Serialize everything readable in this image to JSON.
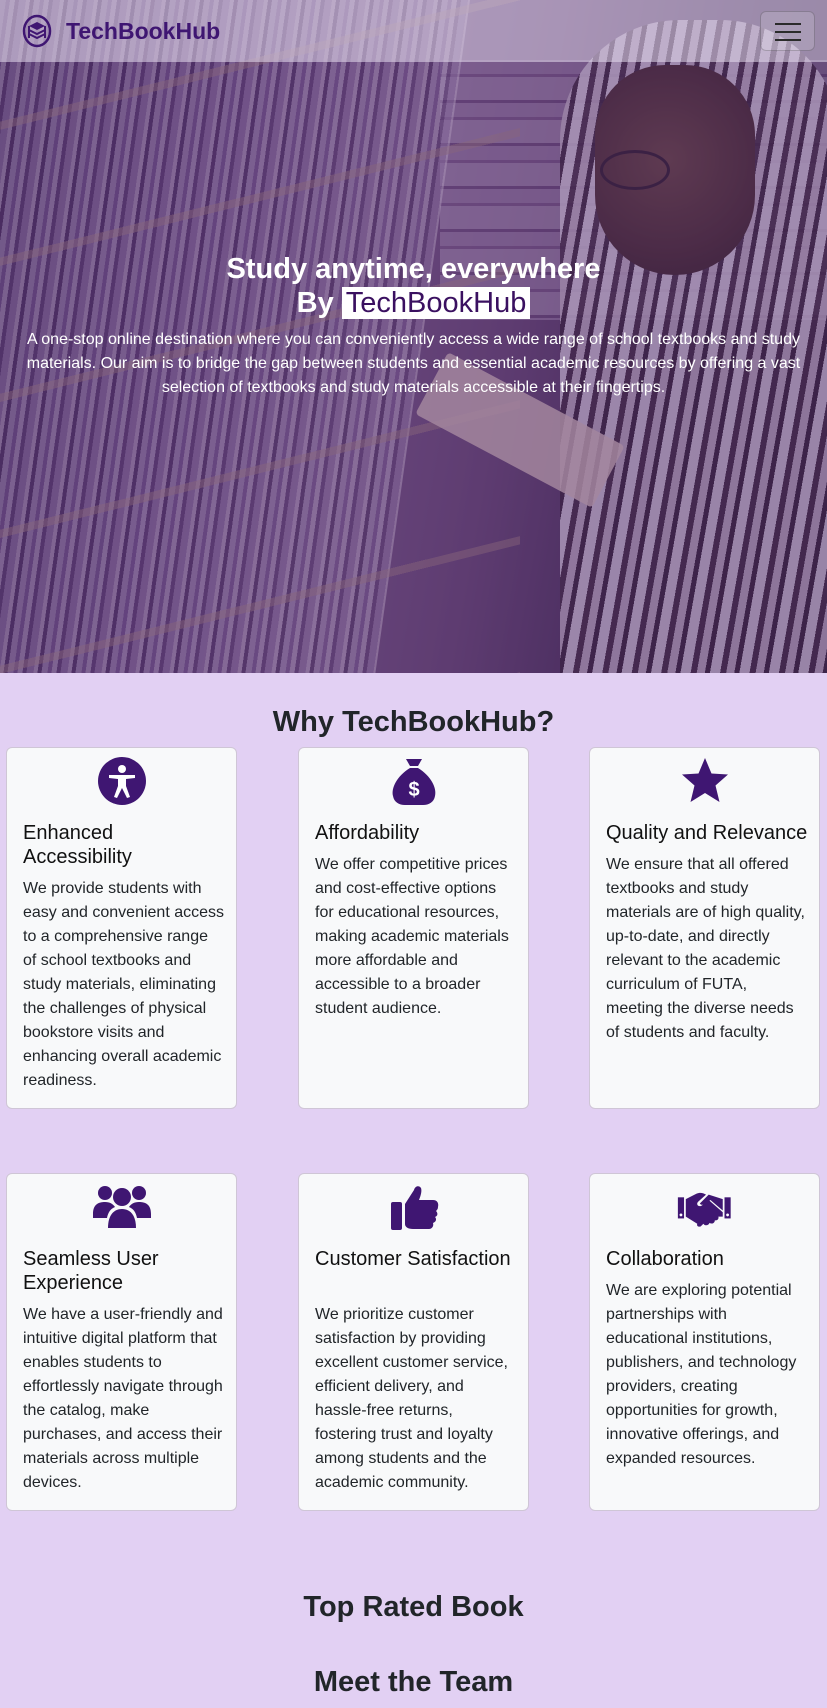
{
  "navbar": {
    "brand_name": "TechBookHub",
    "logo_icon": "book-stack-logo-icon",
    "menu_icon": "hamburger-menu-icon"
  },
  "hero": {
    "title": "Study anytime, everywhere",
    "by_prefix": "By",
    "brand": "TechBookHub",
    "description": "A one-stop online destination where you can conveniently access a wide range of school textbooks and study materials. Our aim is to bridge the gap between students and essential academic resources by offering a vast selection of textbooks and study materials accessible at their fingertips."
  },
  "why": {
    "title": "Why TechBookHub?",
    "cards": [
      {
        "icon": "accessibility-icon",
        "title": "Enhanced Accessibility",
        "text": "We provide students with easy and convenient access to a comprehensive range of school textbooks and study materials, eliminating the challenges of physical bookstore visits and enhancing overall academic readiness."
      },
      {
        "icon": "money-bag-icon",
        "title": "Affordability",
        "text": "We offer competitive prices and cost-effective options for educational resources, making academic materials more affordable and accessible to a broader student audience."
      },
      {
        "icon": "star-icon",
        "title": "Quality and Relevance",
        "text": "We ensure that all offered textbooks and study materials are of high quality, up-to-date, and directly relevant to the academic curriculum of FUTA, meeting the diverse needs of students and faculty."
      },
      {
        "icon": "users-icon",
        "title": "Seamless User Experience",
        "text": "We have a user-friendly and intuitive digital platform that enables students to effortlessly navigate through the catalog, make purchases, and access their materials across multiple devices."
      },
      {
        "icon": "thumbs-up-icon",
        "title": "Customer Satisfaction",
        "text": "We prioritize customer satisfaction by providing excellent customer service, efficient delivery, and hassle-free returns, fostering trust and loyalty among students and the academic community."
      },
      {
        "icon": "handshake-icon",
        "title": "Collaboration",
        "text": "We are exploring potential partnerships with educational institutions, publishers, and technology providers, creating opportunities for growth, innovative offerings, and expanded resources."
      }
    ]
  },
  "top_rated": {
    "title": "Top Rated Book"
  },
  "team": {
    "title": "Meet the Team"
  },
  "colors": {
    "brand": "#3f1672",
    "background": "#e2d0f3",
    "card": "#f8f9fa"
  }
}
